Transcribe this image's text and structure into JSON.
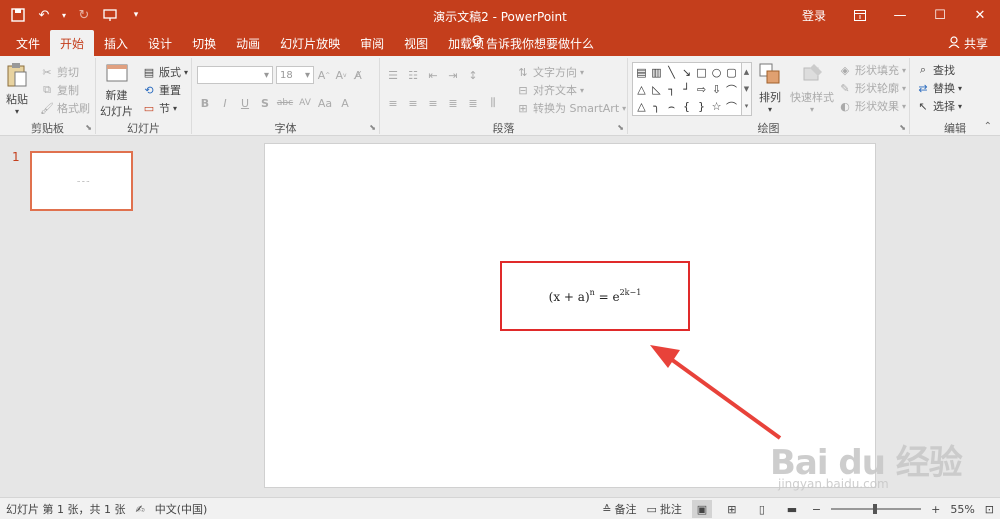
{
  "titlebar": {
    "title": "演示文稿2 - PowerPoint",
    "login": "登录"
  },
  "tabs": [
    "文件",
    "开始",
    "插入",
    "设计",
    "切换",
    "动画",
    "幻灯片放映",
    "审阅",
    "视图",
    "加载项"
  ],
  "active_tab": "开始",
  "tell_me": "告诉我你想要做什么",
  "share": "共享",
  "ribbon": {
    "clipboard": {
      "label": "剪贴板",
      "paste": "粘贴",
      "cut": "剪切",
      "copy": "复制",
      "format_painter": "格式刷"
    },
    "slides": {
      "label": "幻灯片",
      "new_slide_1": "新建",
      "new_slide_2": "幻灯片",
      "layout": "版式",
      "reset": "重置",
      "section": "节"
    },
    "font": {
      "label": "字体",
      "font_size": "18"
    },
    "paragraph": {
      "label": "段落",
      "text_direction": "文字方向",
      "align_text": "对齐文本",
      "smartart": "转换为 SmartArt"
    },
    "drawing": {
      "label": "绘图",
      "arrange": "排列",
      "quick_styles": "快速样式",
      "shape_fill": "形状填充",
      "shape_outline": "形状轮廓",
      "shape_effects": "形状效果"
    },
    "editing": {
      "label": "编辑",
      "find": "查找",
      "replace": "替换",
      "select": "选择"
    }
  },
  "thumbnail": {
    "number": "1"
  },
  "equation": {
    "base": "(x + a)",
    "exp1": "n",
    "eq": " = e",
    "exp2": "2k−1"
  },
  "watermark": {
    "main": "Bai du 经验",
    "sub": "jingyan.baidu.com"
  },
  "statusbar": {
    "slide_info": "幻灯片 第 1 张，共 1 张",
    "language": "中文(中国)",
    "notes": "备注",
    "comments": "批注",
    "zoom": "55%"
  },
  "colors": {
    "accent": "#c43e1c",
    "highlight_box": "#e02a2a"
  }
}
